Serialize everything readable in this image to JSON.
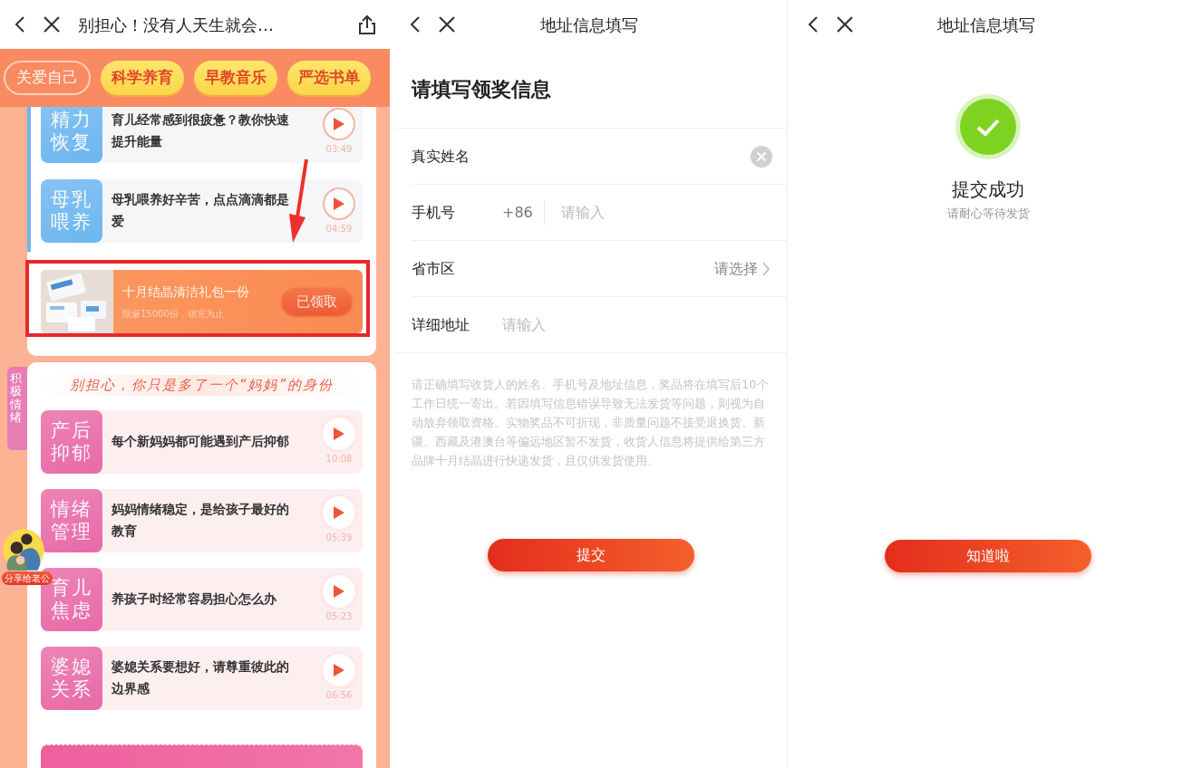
{
  "article_screen": {
    "nav": {
      "title": "别担心！没有人天生就会…"
    },
    "tabs": [
      {
        "label": "关爱自己",
        "selected": true
      },
      {
        "label": "科学养育",
        "selected": false
      },
      {
        "label": "早教音乐",
        "selected": false
      },
      {
        "label": "严选书单",
        "selected": false
      }
    ],
    "sections": [
      {
        "kind": "outline",
        "items": [
          {
            "tag": "精力恢复",
            "title": "育儿经常感到很疲惫？教你快速提升能量",
            "duration": "03:49",
            "color": "#6cb6f0"
          },
          {
            "tag": "母乳喂养",
            "title": "母乳喂养好辛苦，点点滴滴都是爱",
            "duration": "04:59",
            "color": "#6cb6f0"
          }
        ],
        "gift": {
          "title": "十月结晶清洁礼包一份",
          "note": "限量15000份，领完为止",
          "button": "已领取"
        }
      },
      {
        "kind": "solid",
        "side_label": "积极情绪",
        "heading": "别担心，你只是多了一个“妈妈”的身份",
        "items": [
          {
            "tag": "产后抑郁",
            "title": "每个新妈妈都可能遇到产后抑郁",
            "duration": "10:08",
            "color": "#e86aa8"
          },
          {
            "tag": "情绪管理",
            "title": "妈妈情绪稳定，是给孩子最好的教育",
            "duration": "05:39",
            "color": "#e86aa8"
          },
          {
            "tag": "育儿焦虑",
            "title": "养孩子时经常容易担心怎么办",
            "duration": "05:23",
            "color": "#e86aa8"
          },
          {
            "tag": "婆媳关系",
            "title": "婆媳关系要想好，请尊重彼此的边界感",
            "duration": "06:56",
            "color": "#e86aa8"
          }
        ]
      }
    ],
    "share_badge": {
      "label": "分享给老公"
    }
  },
  "form_screen": {
    "nav": {
      "title": "地址信息填写"
    },
    "heading": "请填写领奖信息",
    "fields": [
      {
        "kind": "text",
        "label": "真实姓名",
        "clearable": true
      },
      {
        "kind": "phone",
        "label": "手机号",
        "prefix": "+86",
        "placeholder": "请输入"
      },
      {
        "kind": "select",
        "label": "省市区",
        "placeholder": "请选择"
      },
      {
        "kind": "text",
        "label": "详细地址",
        "placeholder": "请输入",
        "clearable": false
      }
    ],
    "notice": "请正确填写收货人的姓名、手机号及地址信息，奖品将在填写后10个工作日统一寄出。若因填写信息错误导致无法发货等问题，则视为自动放弃领取资格。实物奖品不可折现，非质量问题不接受退换货。新疆、西藏及港澳台等偏远地区暂不发货，收货人信息将提供给第三方品牌十月结晶进行快递发货，且仅供发货使用。",
    "submit": "提交"
  },
  "success_screen": {
    "nav": {
      "title": "地址信息填写"
    },
    "title": "提交成功",
    "subtitle": "请耐心等待发货",
    "button": "知道啦"
  }
}
